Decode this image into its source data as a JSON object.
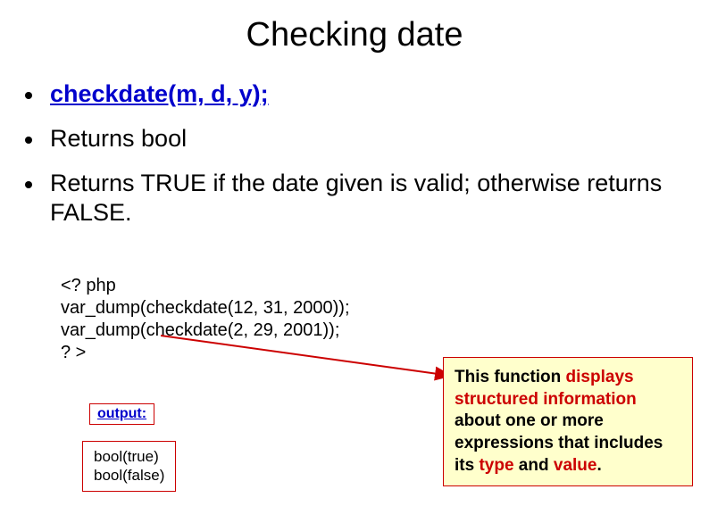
{
  "title": "Checking date",
  "bullets": {
    "b1": "checkdate(m, d, y);",
    "b2": "Returns bool",
    "b3": "Returns TRUE if the date given is valid; otherwise returns FALSE."
  },
  "code": {
    "l1": "<? php",
    "l2": "var_dump(checkdate(12, 31, 2000));",
    "l3": "var_dump(checkdate(2, 29, 2001));",
    "l4": "? >"
  },
  "output_label": "output:",
  "output": {
    "l1": "bool(true)",
    "l2": "bool(false)"
  },
  "desc": {
    "t1": "This function ",
    "t2": "displays structured information",
    "t3": " about one or more expressions that includes its ",
    "t4": "type",
    "t5": " and ",
    "t6": "value",
    "t7": "."
  }
}
